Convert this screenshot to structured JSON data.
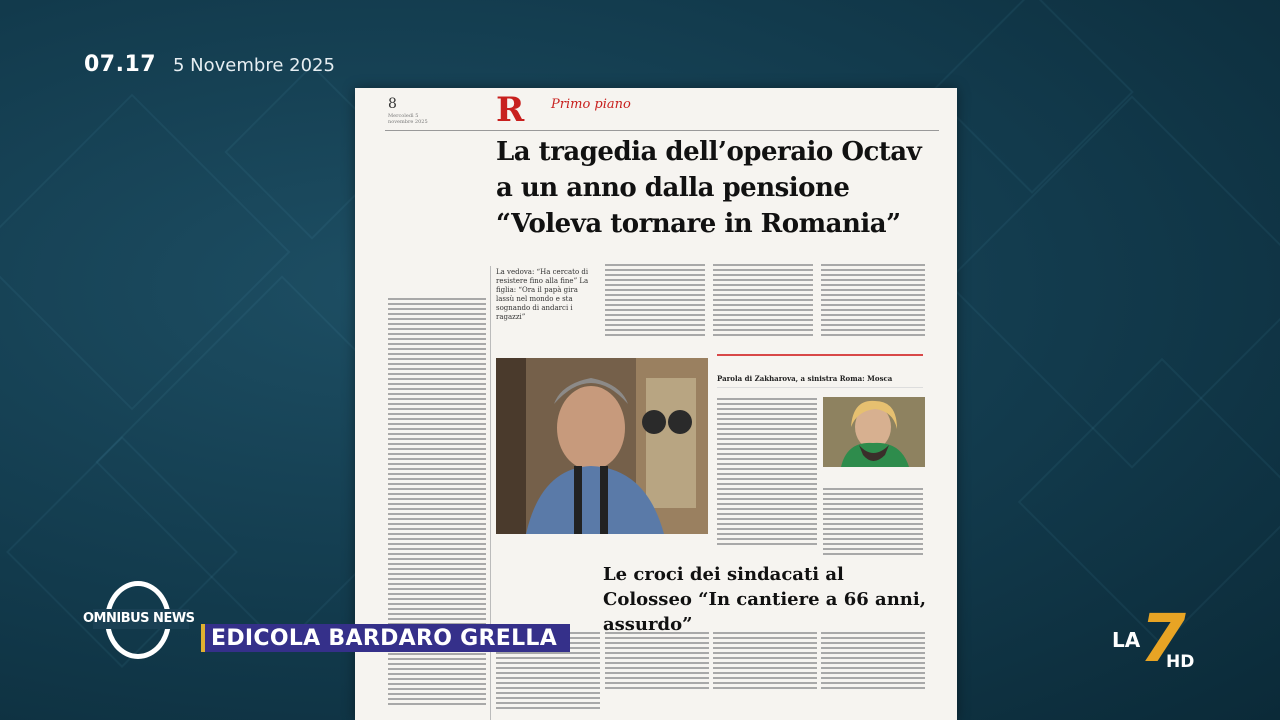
{
  "header": {
    "time": "07.17",
    "date": "5 Novembre 2025"
  },
  "newspaper": {
    "page_number": "8",
    "page_date": "Mercoledì 5 novembre 2025",
    "logo": "R",
    "section": "Primo piano",
    "headline": "La tragedia dell’operaio Octav a un anno dalla pensione “Voleva tornare in Romania”",
    "subheadline": "La vedova: “Ha cercato di resistere fino alla fine” La figlia: “Ora il papà gira lassù nel mondo e sta sognando di andarci i ragazzi”",
    "sidebox_title": "Parola di Zakharova, a sinistra Roma: Mosca",
    "headline2": "Le croci dei sindacati al Colosseo “In cantiere a 66 anni, assurdo”"
  },
  "lower_third": {
    "program": "OMNIBUS NEWS",
    "banner": "EDICOLA BARDARO GRELLA"
  },
  "channel": {
    "name": "LA",
    "number": "7",
    "hd": "HD"
  },
  "colors": {
    "banner": "#35308a",
    "accent": "#e8a424",
    "masthead_red": "#c8201e"
  }
}
